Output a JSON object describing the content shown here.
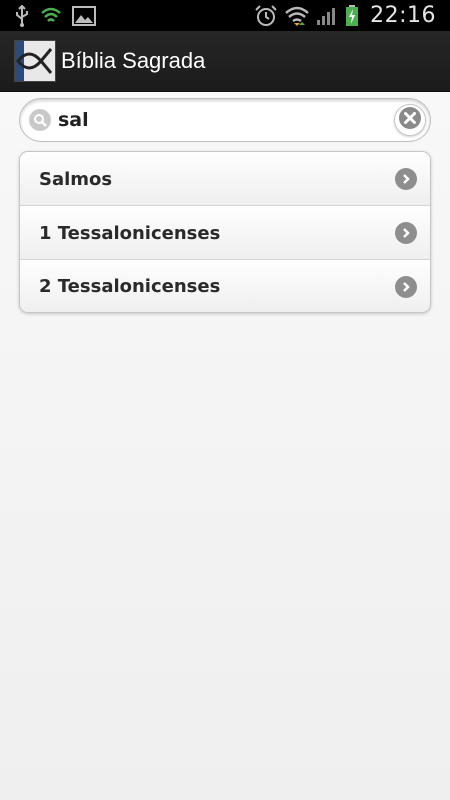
{
  "status_bar": {
    "time": "22:16",
    "icons_left": [
      "usb-icon",
      "wifi-signal-icon",
      "gallery-icon"
    ],
    "icons_right": [
      "alarm-icon",
      "wifi-icon",
      "cell-signal-icon",
      "battery-charging-icon"
    ],
    "accent_green": "#4caf50"
  },
  "action_bar": {
    "app_title": "Bíblia Sagrada",
    "logo_icon": "ichthys-logo-icon"
  },
  "search": {
    "value": "sal",
    "search_icon": "search-icon",
    "clear_icon": "clear-icon"
  },
  "results": {
    "items": [
      {
        "label": "Salmos"
      },
      {
        "label": "1 Tessalonicenses"
      },
      {
        "label": "2 Tessalonicenses"
      }
    ],
    "item_icon": "chevron-right-icon"
  }
}
